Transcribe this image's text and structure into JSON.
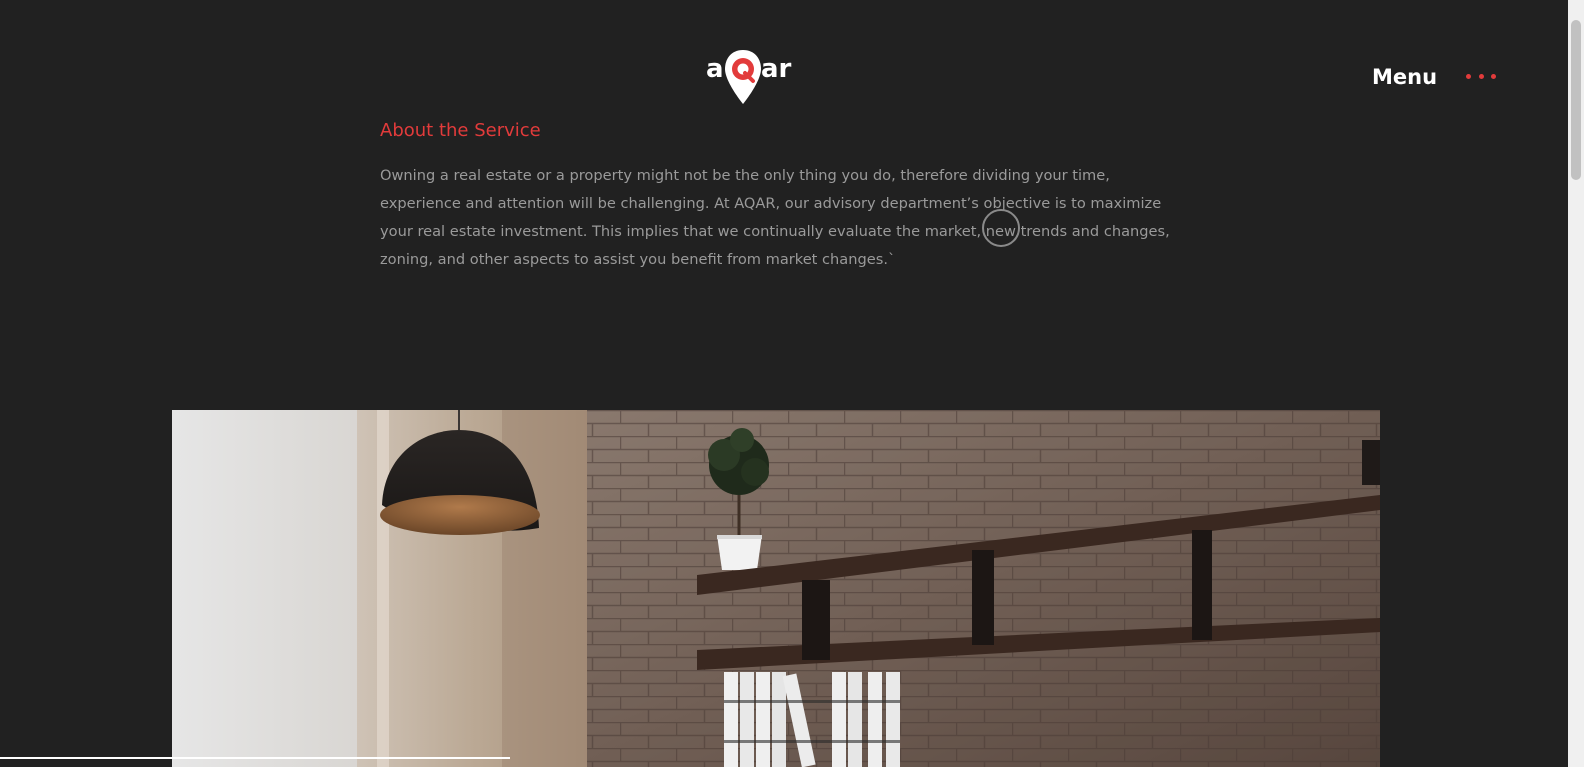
{
  "header": {
    "logo": {
      "prefix": "a",
      "highlight": "Q",
      "suffix": "ar",
      "icon": "map-pin-icon",
      "accent_color": "#e23b3b"
    },
    "menu_label": "Menu",
    "menu_icon": "three-dots-icon"
  },
  "about": {
    "title": "About the Service",
    "body": "Owning a real estate or a property might not be the only thing you do, therefore dividing your time, experience and attention will be challenging. At AQAR, our advisory department’s objective is to maximize your real estate investment. This implies that we continually evaluate the market, new trends and changes, zoning, and other aspects to assist you benefit from market changes.`"
  },
  "hero": {
    "image": "office-interior-photo",
    "description_icons": [
      "pendant-lamp",
      "potted-plant",
      "wall-shelves",
      "binders",
      "brick-wall"
    ]
  },
  "colors": {
    "background": "#212121",
    "accent": "#e23b3b",
    "text_muted": "#9a9a9a",
    "text_light": "#ffffff"
  }
}
